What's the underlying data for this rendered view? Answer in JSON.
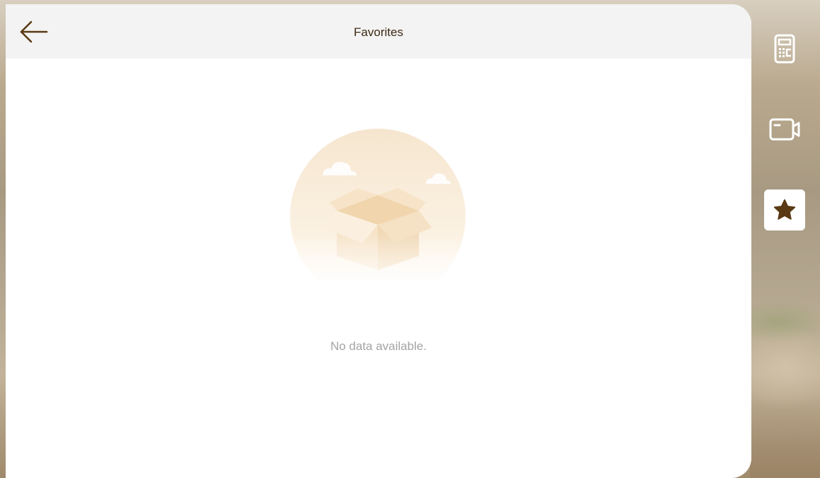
{
  "header": {
    "title": "Favorites"
  },
  "empty_state": {
    "message": "No data available."
  },
  "rail": {
    "items": [
      {
        "icon": "intercom-keypad-icon",
        "active": false
      },
      {
        "icon": "video-camera-icon",
        "active": false
      },
      {
        "icon": "star-icon",
        "active": true
      }
    ]
  },
  "colors": {
    "accent": "#5a3a14",
    "header_bg": "#f4f3f3",
    "title_text": "#3b2a14",
    "muted_text": "#a3a3a3"
  }
}
